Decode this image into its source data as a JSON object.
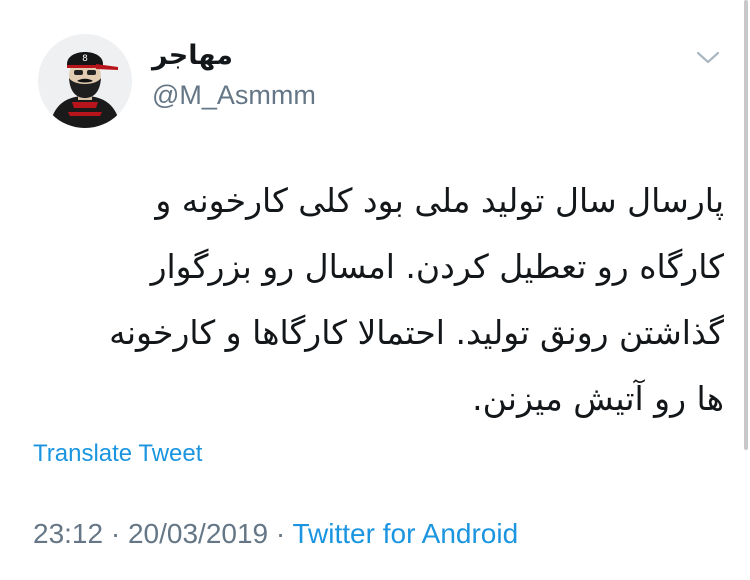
{
  "user": {
    "display_name": "مهاجر",
    "handle": "@M_Asmmm",
    "avatar": "avatar-image"
  },
  "menu": {
    "icon": "chevron-down-icon"
  },
  "tweet": {
    "lines": [
      "پارسال سال تولید ملی بود کلی کارخونه و",
      "کارگاه رو تعطیل کردن. امسال رو بزرگوار",
      "گذاشتن رونق تولید. احتمالا کارگاها و کارخونه",
      "ها رو آتیش میزنن."
    ]
  },
  "translate_label": "Translate Tweet",
  "meta": {
    "time": "23:12",
    "separator": " · ",
    "date": "20/03/2019",
    "source": "Twitter for Android"
  },
  "colors": {
    "link": "#1b95e0",
    "secondary": "#657786",
    "text": "#14171a"
  }
}
